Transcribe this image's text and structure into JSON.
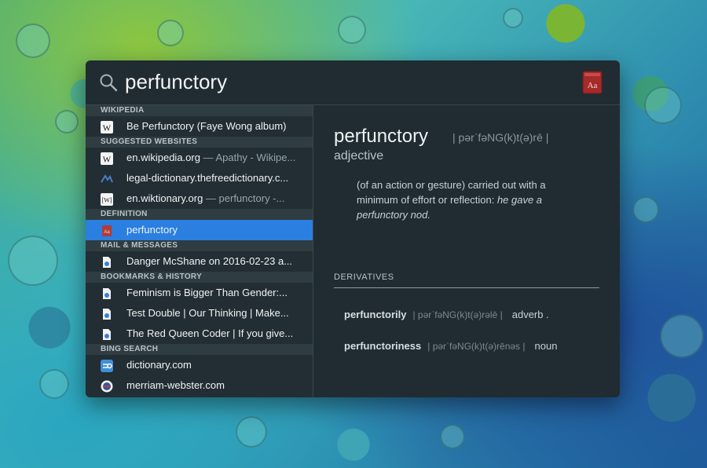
{
  "search": {
    "query": "perfunctory"
  },
  "icons": {
    "search": "search-icon",
    "dictionary_app": "dictionary-app-icon"
  },
  "colors": {
    "selection": "#2a7fe0",
    "panel": "#202c31"
  },
  "results": {
    "sections": [
      {
        "header": "WIKIPEDIA",
        "rows": [
          {
            "icon": "wikipedia-icon",
            "title": "Be Perfunctory (Faye Wong album)",
            "sub": ""
          }
        ]
      },
      {
        "header": "SUGGESTED WEBSITES",
        "rows": [
          {
            "icon": "wikipedia-icon",
            "title": "en.wikipedia.org",
            "sub": " — Apathy - Wikipe..."
          },
          {
            "icon": "free-dictionary-icon",
            "title": "legal-dictionary.thefreedictionary.c...",
            "sub": ""
          },
          {
            "icon": "wiktionary-icon",
            "title": "en.wiktionary.org",
            "sub": " — perfunctory -..."
          }
        ]
      },
      {
        "header": "DEFINITION",
        "rows": [
          {
            "icon": "dictionary-icon",
            "title": "perfunctory",
            "sub": "",
            "selected": true
          }
        ]
      },
      {
        "header": "MAIL & MESSAGES",
        "rows": [
          {
            "icon": "document-icon",
            "title": "Danger McShane on 2016-02-23 a...",
            "sub": ""
          }
        ]
      },
      {
        "header": "BOOKMARKS & HISTORY",
        "rows": [
          {
            "icon": "document-icon",
            "title": "Feminism is Bigger Than Gender:...",
            "sub": ""
          },
          {
            "icon": "document-icon",
            "title": "Test Double | Our Thinking | Make...",
            "sub": ""
          },
          {
            "icon": "document-icon",
            "title": "The Red Queen Coder | If you give...",
            "sub": ""
          }
        ]
      },
      {
        "header": "BING SEARCH",
        "rows": [
          {
            "icon": "website-icon",
            "title": "dictionary.com",
            "sub": ""
          },
          {
            "icon": "merriam-webster-icon",
            "title": "merriam-webster.com",
            "sub": ""
          }
        ]
      }
    ]
  },
  "preview": {
    "word": "perfunctory",
    "pronunciation": "| pərˈfəNG(k)t(ə)rē |",
    "part_of_speech": "adjective",
    "definition": "(of an action or gesture) carried out with a minimum of effort or reflection: ",
    "example": "he gave a perfunctory nod.",
    "derivatives_header": "DERIVATIVES",
    "derivatives": [
      {
        "word": "perfunctorily",
        "pron": "| pərˈfəNG(k)t(ə)rəlē |",
        "pos": "adverb ."
      },
      {
        "word": "perfunctoriness",
        "pron": "| pərˈfəNG(k)t(ə)rēnəs |",
        "pos": "noun"
      }
    ]
  }
}
